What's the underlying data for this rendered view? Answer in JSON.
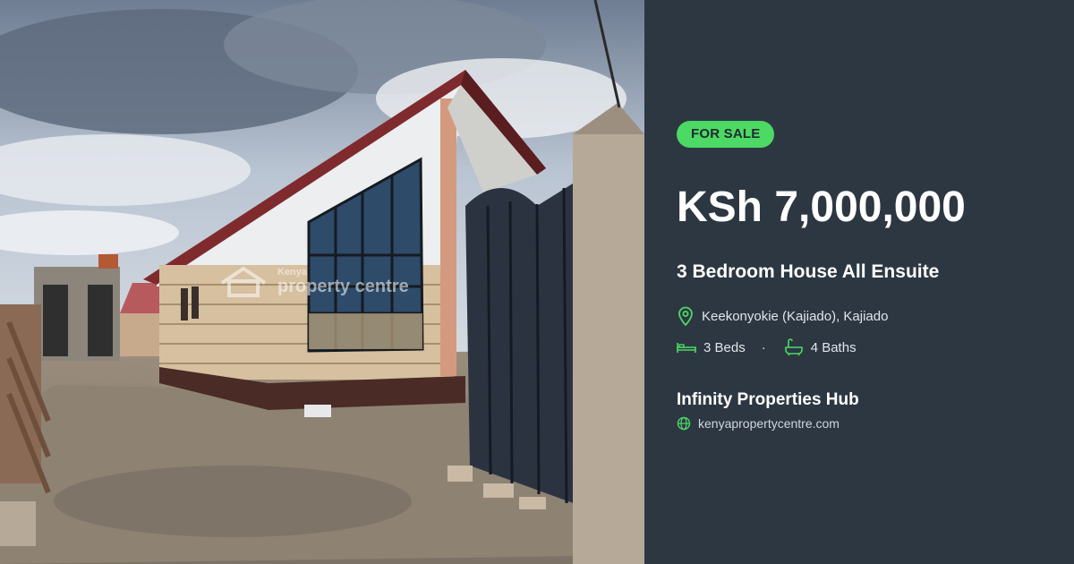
{
  "listing": {
    "status_badge": "FOR SALE",
    "price": "KSh 7,000,000",
    "title": "3 Bedroom House All Ensuite",
    "location": "Keekonyokie (Kajiado), Kajiado",
    "beds": "3 Beds",
    "baths": "4 Baths",
    "separator": "·"
  },
  "agent": {
    "name": "Infinity Properties Hub",
    "website": "kenyapropertycentre.com"
  },
  "watermark": {
    "line1": "Kenya",
    "line2": "property centre"
  },
  "colors": {
    "panel_background": "#2d3742",
    "accent_green": "#4cd964",
    "text_primary": "#ffffff"
  },
  "icons": {
    "location": "map-pin-icon",
    "beds": "bed-icon",
    "baths": "bathtub-icon",
    "website": "globe-icon"
  }
}
